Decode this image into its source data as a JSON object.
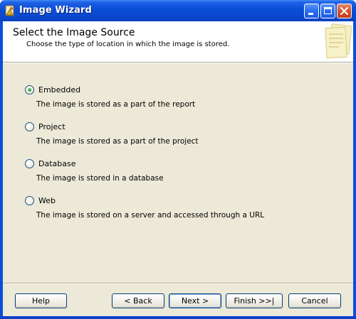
{
  "window": {
    "title": "Image Wizard"
  },
  "header": {
    "title": "Select the Image Source",
    "subtitle": "Choose the type of location in which the image is stored."
  },
  "options": [
    {
      "label": "Embedded",
      "description": "The image is stored as a part of the report",
      "selected": true
    },
    {
      "label": "Project",
      "description": "The image is stored as a part of the project",
      "selected": false
    },
    {
      "label": "Database",
      "description": "The image is stored in a database",
      "selected": false
    },
    {
      "label": "Web",
      "description": "The image is stored on a server and accessed through a URL",
      "selected": false
    }
  ],
  "buttons": {
    "help": "Help",
    "back": "< Back",
    "next": "Next >",
    "finish": "Finish >>|",
    "cancel": "Cancel"
  },
  "colors": {
    "titlebar": "#0a4ed6",
    "dialog_bg": "#ece9d8",
    "header_bg": "#ffffff",
    "radio_selected": "#25a33a"
  },
  "icons": {
    "app": "image-wizard-icon",
    "header_art": "document-stack-icon",
    "minimize": "minimize-icon",
    "maximize": "maximize-icon",
    "close": "close-icon"
  }
}
